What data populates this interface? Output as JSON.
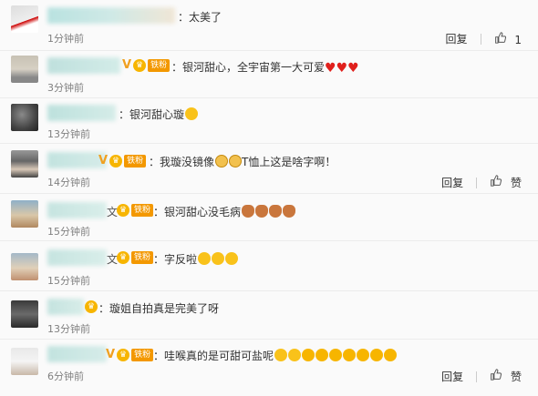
{
  "comments": [
    {
      "text": "：太美了",
      "time": "1分钟前",
      "reply": "回复",
      "likes": "1"
    },
    {
      "text": "：银河甜心，全宇宙第一大可爱",
      "time": "3分钟前",
      "fan_badge": "铁粉"
    },
    {
      "text": "：银河甜心璇",
      "time": "13分钟前"
    },
    {
      "text": "：我璇没镜像",
      "text2": "T恤上这是啥字啊！",
      "time": "14分钟前",
      "reply": "回复",
      "likes_label": "赞",
      "fan_badge": "铁粉"
    },
    {
      "text": "：银河甜心没毛病",
      "time": "15分钟前",
      "fan_badge": "铁粉",
      "name_suffix": "文"
    },
    {
      "text": "：字反啦",
      "time": "15分钟前",
      "fan_badge": "铁粉",
      "name_suffix": "文"
    },
    {
      "text": "：璇姐自拍真是完美了呀",
      "time": "13分钟前"
    },
    {
      "text": "：哇喉真的是可甜可盐呢",
      "time": "6分钟前",
      "reply": "回复",
      "likes_label": "赞",
      "fan_badge": "铁粉"
    }
  ],
  "icons": {
    "like": "thumb-up-icon",
    "heart": "heart-icon",
    "crown": "crown-badge-icon",
    "vip": "v-badge-icon"
  },
  "colors": {
    "fan_badge": "#f39800",
    "heart": "#e0201c"
  }
}
